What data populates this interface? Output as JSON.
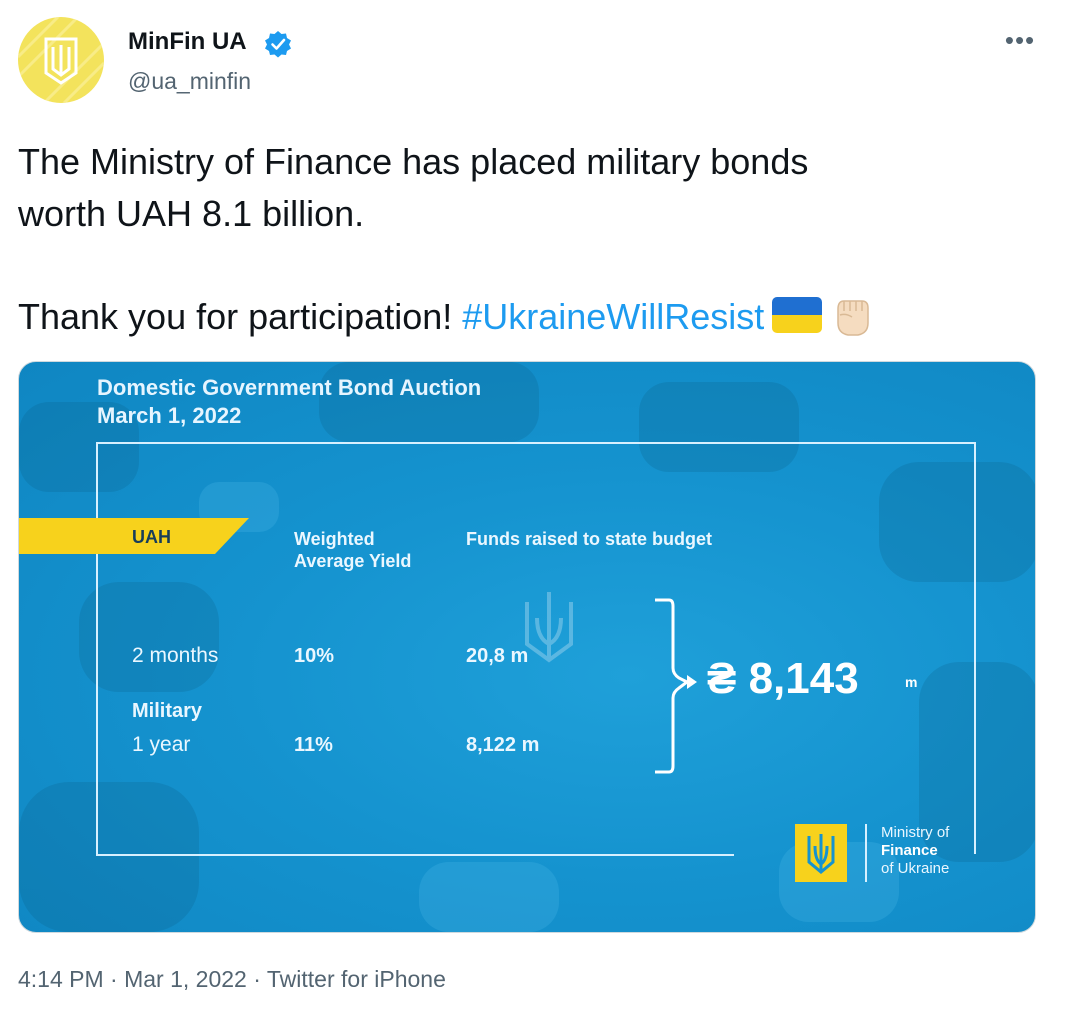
{
  "account": {
    "display_name": "MinFin UA",
    "handle": "@ua_minfin",
    "verified": true,
    "avatar_icon": "trident-emblem-icon",
    "avatar_color": "#f3e35c"
  },
  "more_label": "•••",
  "tweet": {
    "line1": "The Ministry of Finance has placed military bonds",
    "line2": "worth UAH 8.1 billion.",
    "line3_prefix": "Thank you for participation! ",
    "hashtag": "#UkraineWillResist",
    "emojis": [
      "ukraine-flag-icon",
      "raised-fist-icon"
    ]
  },
  "media": {
    "title_line1": "Domestic Government Bond Auction",
    "title_line2": "March 1, 2022",
    "currency_label": "UAH",
    "col_yield_line1": "Weighted",
    "col_yield_line2": "Average Yield",
    "col_funds": "Funds raised to state budget",
    "rows": [
      {
        "term": "2 months",
        "yield": "10%",
        "funds": "20,8 m"
      },
      {
        "term_prefix": "Military",
        "term": "1 year",
        "yield": "11%",
        "funds": "8,122 m"
      }
    ],
    "total": "₴ 8,143",
    "total_unit": "m",
    "brand_line1": "Ministry of",
    "brand_line2": "Finance",
    "brand_line3": "of Ukraine",
    "colors": {
      "background": "#1593cf",
      "accent_yellow": "#f7d21c",
      "text": "#eaf7ff"
    }
  },
  "footer": {
    "time": "4:14 PM",
    "date": "Mar 1, 2022",
    "source": "Twitter for iPhone",
    "separator": " · "
  }
}
